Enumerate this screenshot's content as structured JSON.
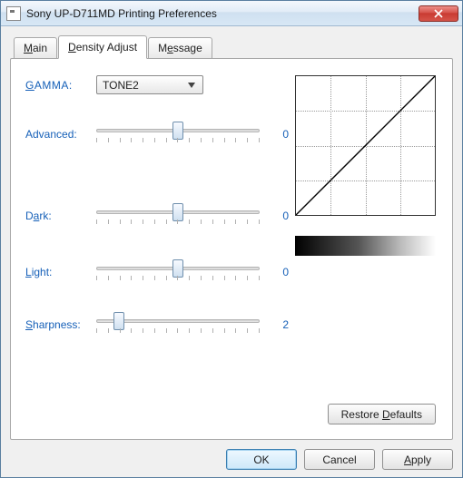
{
  "window": {
    "title": "Sony UP-D711MD Printing Preferences"
  },
  "tabs": {
    "main": "Main",
    "density": "Density Adjust",
    "message": "Message"
  },
  "density": {
    "gamma_label": "GAMMA:",
    "gamma_value": "TONE2",
    "sliders": {
      "advanced": {
        "label": "Advanced:",
        "value": "0",
        "pos_pct": 50
      },
      "dark": {
        "label": "Dark:",
        "value": "0",
        "pos_pct": 50
      },
      "light": {
        "label": "Light:",
        "value": "0",
        "pos_pct": 50
      },
      "sharpness": {
        "label": "Sharpness:",
        "value": "2",
        "pos_pct": 14
      }
    },
    "restore": "Restore Defaults"
  },
  "footer": {
    "ok": "OK",
    "cancel": "Cancel",
    "apply": "Apply"
  },
  "hotkeys": {
    "main": "M",
    "density": "D",
    "message": "e",
    "gamma": "G",
    "dark": "a",
    "light": "L",
    "sharpness": "S",
    "restore": "D",
    "apply": "A"
  },
  "chart_data": {
    "type": "line",
    "title": "",
    "x": [
      0,
      1
    ],
    "y": [
      0,
      1
    ],
    "xlim": [
      0,
      1
    ],
    "ylim": [
      0,
      1
    ],
    "grid": {
      "x_divisions": 4,
      "y_divisions": 4,
      "style": "dotted"
    },
    "note": "Tone curve: identity (linear) mapping"
  }
}
